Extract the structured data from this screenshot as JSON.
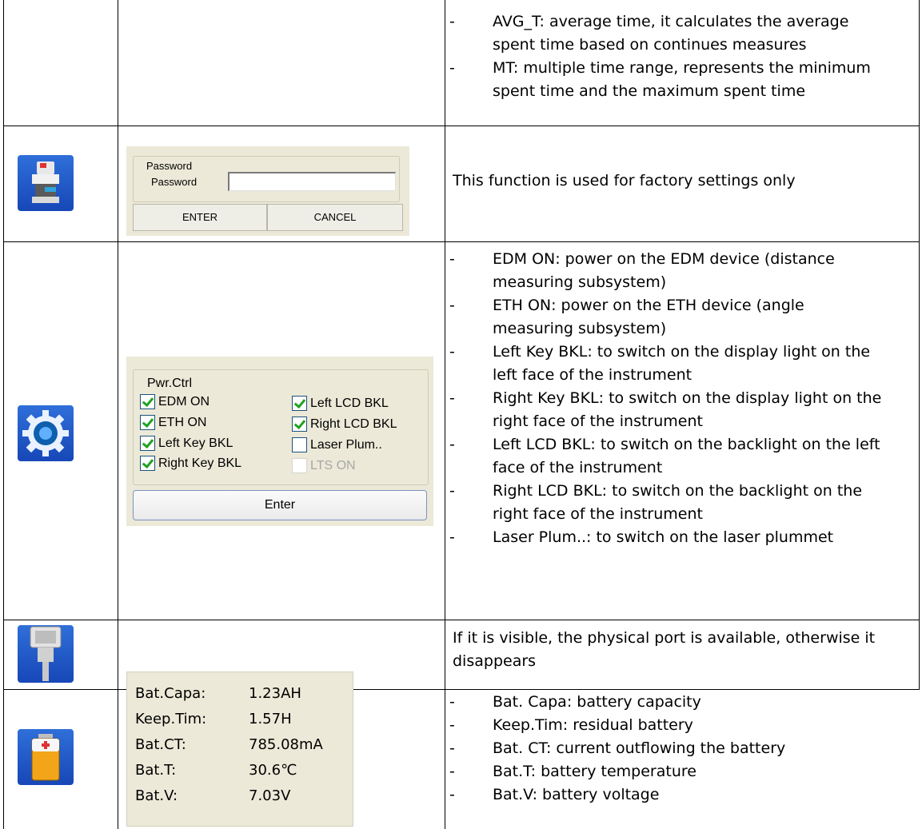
{
  "rows": [
    {
      "items": [
        "AVG_T: average time, it calculates the average",
        "spent time based on continues measures",
        "MT: multiple time range, represents the minimum",
        "spent time and the maximum spent time"
      ]
    },
    {
      "icon": "factory-instrument-icon",
      "panel": {
        "group_title": "Password",
        "field_label": "Password",
        "field_value": "",
        "enter_label": "ENTER",
        "cancel_label": "CANCEL"
      },
      "text": "This function is used for factory settings only"
    },
    {
      "icon": "gear-settings-icon",
      "panel": {
        "group_title": "Pwr.Ctrl",
        "checkboxes": [
          {
            "label": "EDM ON",
            "checked": true
          },
          {
            "label": "ETH ON",
            "checked": true
          },
          {
            "label": "Left Key BKL",
            "checked": true
          },
          {
            "label": "Right Key BKL",
            "checked": true
          },
          {
            "label": "Left LCD BKL",
            "checked": true
          },
          {
            "label": "Right LCD BKL",
            "checked": true
          },
          {
            "label": "Laser Plum..",
            "checked": false
          },
          {
            "label": "LTS ON",
            "checked": false,
            "disabled": true
          }
        ],
        "enter_label": "Enter"
      },
      "items": [
        "EDM ON: power on the EDM device (distance",
        "measuring subsystem)",
        "ETH ON: power on the ETH device (angle",
        "measuring subsystem)",
        "Left Key BKL: to switch on the display light on the",
        "left face of the instrument",
        "Right Key BKL: to switch on the display light on the",
        "right face of the instrument",
        "Left LCD BKL: to switch on the backlight on the left",
        "face of the instrument",
        "Right LCD BKL: to switch on the backlight on the",
        "right face of the instrument",
        "Laser Plum..: to switch on the laser plummet"
      ]
    },
    {
      "icon": "serial-port-icon",
      "text_lines": [
        "If it is visible, the physical port is available, otherwise it",
        "disappears"
      ]
    },
    {
      "icon": "battery-icon",
      "panel": {
        "rows": [
          {
            "label": "Bat.Capa:",
            "value": "1.23AH"
          },
          {
            "label": "Keep.Tim:",
            "value": "1.57H"
          },
          {
            "label": "Bat.CT:",
            "value": "785.08mA"
          },
          {
            "label": "Bat.T:",
            "value": "30.6℃"
          },
          {
            "label": "Bat.V:",
            "value": "7.03V"
          }
        ]
      },
      "items": [
        "Bat. Capa: battery capacity",
        "Keep.Tim: residual battery",
        "Bat. CT: current outflowing the battery",
        "Bat.T: battery temperature",
        "Bat.V: battery voltage"
      ]
    }
  ]
}
